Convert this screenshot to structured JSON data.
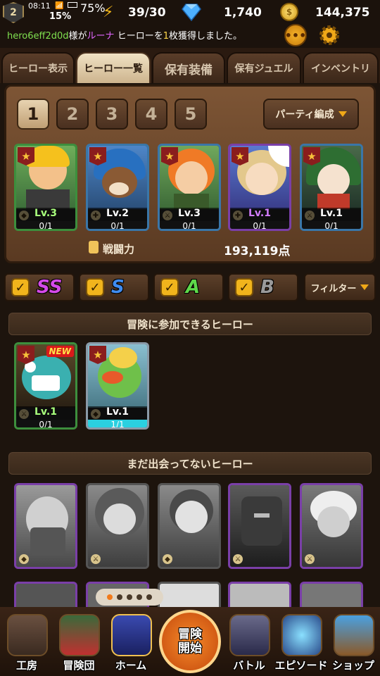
{
  "status": {
    "level": "2",
    "time": "08:11",
    "battery_icon_pct": "75%",
    "signal_pct": "15%"
  },
  "resources": {
    "stamina": "39/30",
    "gems": "1,740",
    "gold": "144,375"
  },
  "message": {
    "user": "hero6eff2d0d",
    "p1": "様が",
    "hero": "ルーナ",
    "p2": " ヒーローを",
    "count": "1",
    "p3": "枚獲得しました。"
  },
  "tabs": [
    {
      "label": "ヒーロー表示"
    },
    {
      "label": "ヒーロー一覧"
    },
    {
      "label": "保有装備"
    },
    {
      "label": "保有ジュエル"
    },
    {
      "label": "インベントリ"
    }
  ],
  "party": {
    "slots": [
      "1",
      "2",
      "3",
      "4",
      "5"
    ],
    "edit_label": "パーティ編成",
    "power_label": "戦闘力",
    "power_value": "193,119点",
    "heroes": [
      {
        "lv": "Lv.3",
        "count": "0/1",
        "cls": "盾",
        "lvcolor": "#a8ff7c",
        "border": "#3d8f3d"
      },
      {
        "lv": "Lv.2",
        "count": "0/1",
        "cls": "✚",
        "lvcolor": "#ffffff",
        "border": "#3a76a8"
      },
      {
        "lv": "Lv.3",
        "count": "0/1",
        "cls": "⚔",
        "lvcolor": "#ffffff",
        "border": "#3a76a8"
      },
      {
        "lv": "Lv.1",
        "count": "0/1",
        "cls": "✚",
        "lvcolor": "#d27cff",
        "border": "#7a3fa8"
      },
      {
        "lv": "Lv.1",
        "count": "0/1",
        "cls": "⚔",
        "lvcolor": "#ffffff",
        "border": "#3a76a8"
      }
    ]
  },
  "ranks": [
    {
      "label": "SS",
      "color": "#d64ae8"
    },
    {
      "label": "S",
      "color": "#3f8cf0"
    },
    {
      "label": "A",
      "color": "#5ed84a"
    },
    {
      "label": "B",
      "color": "#9a9a9a"
    }
  ],
  "filter_label": "フィルター",
  "sections": {
    "available": "冒険に参加できるヒーロー",
    "unmet": "まだ出会ってないヒーロー"
  },
  "available": [
    {
      "lv": "Lv.1",
      "count": "0/1",
      "new": "NEW",
      "cls": "⚔",
      "lvcolor": "#a8ff7c"
    },
    {
      "lv": "Lv.1",
      "count": "1/1",
      "cls": "盾",
      "lvcolor": "#ffffff"
    }
  ],
  "nav": [
    {
      "label": "工房"
    },
    {
      "label": "冒険団"
    },
    {
      "label": "ホーム"
    },
    {
      "label": "バトル"
    },
    {
      "label": "エピソード"
    },
    {
      "label": "ショップ"
    }
  ],
  "start_button": {
    "line1": "冒険",
    "line2": "開始"
  },
  "colors": {
    "accent": "#f0a818",
    "panel": "#6b4a30",
    "green": "#7fe04f"
  }
}
